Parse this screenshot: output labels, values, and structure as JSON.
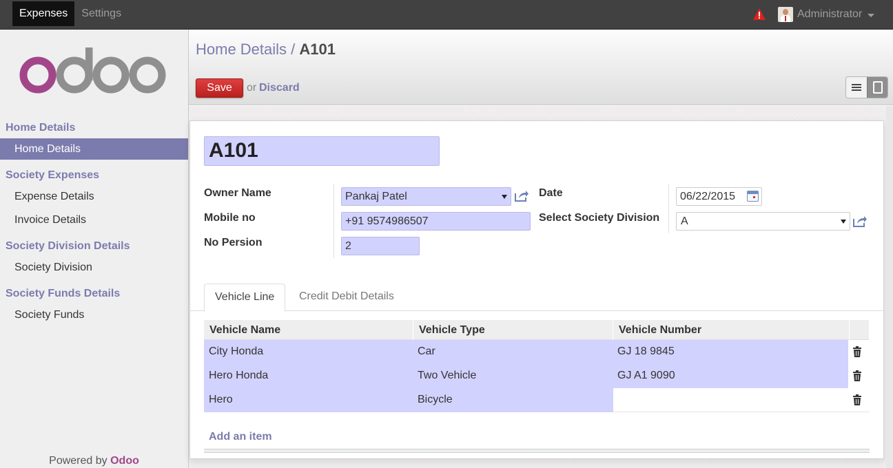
{
  "topbar": {
    "menu": [
      "Expenses",
      "Settings"
    ],
    "user": "Administrator"
  },
  "sidebar": {
    "sections": [
      {
        "title": "Home Details",
        "items": [
          "Home Details"
        ]
      },
      {
        "title": "Society Expenses",
        "items": [
          "Expense Details",
          "Invoice Details"
        ]
      },
      {
        "title": "Society Division Details",
        "items": [
          "Society Division"
        ]
      },
      {
        "title": "Society Funds Details",
        "items": [
          "Society Funds"
        ]
      }
    ],
    "active_item": "Home Details",
    "powered_by": "Powered by",
    "powered_brand": "Odoo"
  },
  "control_panel": {
    "breadcrumb_parent": "Home Details",
    "breadcrumb_sep": "/",
    "breadcrumb_current": "A101",
    "save_label": "Save",
    "or_label": "or",
    "discard_label": "Discard"
  },
  "form": {
    "title": "A101",
    "owner_label": "Owner Name",
    "owner_value": "Pankaj Patel",
    "mobile_label": "Mobile no",
    "mobile_value": "+91 9574986507",
    "persons_label": "No Persion",
    "persons_value": "2",
    "date_label": "Date",
    "date_value": "06/22/2015",
    "division_label": "Select Society Division",
    "division_value": "A"
  },
  "tabs": [
    "Vehicle Line",
    "Credit Debit Details"
  ],
  "vehicles": {
    "columns": [
      "Vehicle Name",
      "Vehicle Type",
      "Vehicle Number"
    ],
    "rows": [
      [
        "City Honda",
        "Car",
        "GJ 18 9845"
      ],
      [
        "Hero Honda",
        "Two Vehicle",
        "GJ A1 9090"
      ],
      [
        "Hero",
        "Bicycle",
        ""
      ]
    ],
    "add_item": "Add an item"
  },
  "colors": {
    "brand": "#7c7bad",
    "save": "#d12e2e",
    "field_required": "#d2d2ff"
  }
}
